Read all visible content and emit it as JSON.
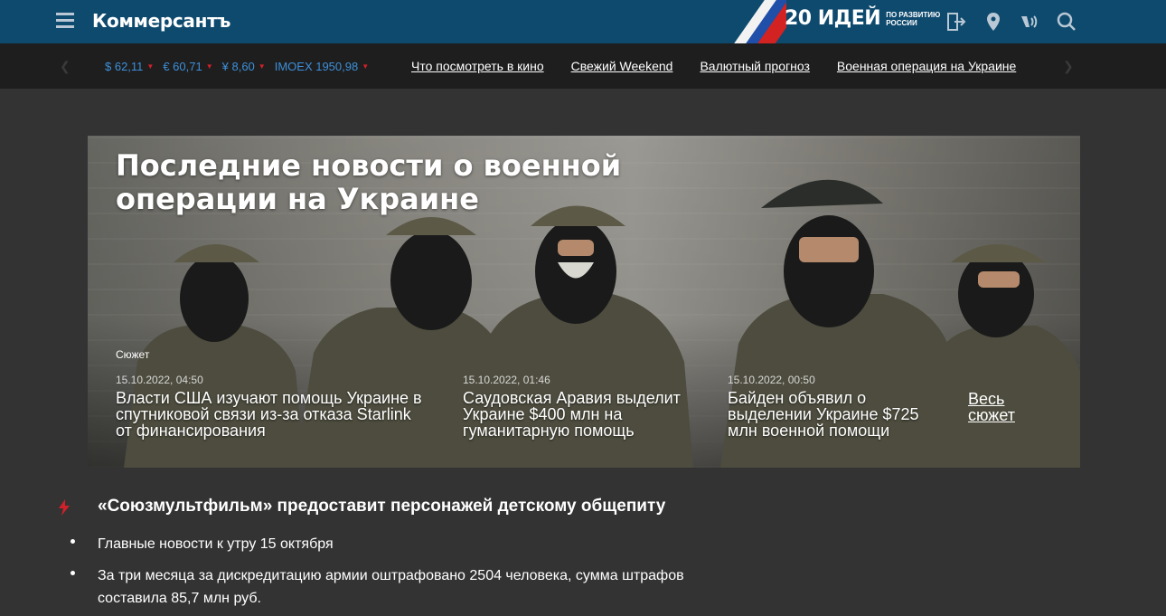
{
  "header": {
    "logo": "Коммерсантъ",
    "promo_big": "20 ИДЕЙ",
    "promo_small_1": "ПО РАЗВИТИЮ",
    "promo_small_2": "РОССИИ",
    "icons": [
      "hamburger-menu-icon",
      "login-icon",
      "location-icon",
      "radio-icon",
      "search-icon"
    ]
  },
  "subnav": {
    "rates": [
      {
        "label": "$ 62,11",
        "trend": "down"
      },
      {
        "label": "€ 60,71",
        "trend": "down"
      },
      {
        "label": "¥ 8,60",
        "trend": "down"
      },
      {
        "label": "IMOEX 1950,98",
        "trend": "down"
      }
    ],
    "links": [
      "Что посмотреть в кино",
      "Свежий Weekend",
      "Валютный прогноз",
      "Военная операция на Украине"
    ]
  },
  "hero": {
    "title_line1": "Последние новости о военной",
    "title_line2": "операции на Украине",
    "tag": "Сюжет",
    "stories": [
      {
        "date": "15.10.2022, 04:50",
        "headline": "Власти США изучают помощь Украине в спутниковой связи из-за отказа Starlink от финансирования"
      },
      {
        "date": "15.10.2022, 01:46",
        "headline": "Саудовская Аравия выделит Украине $400 млн на гуманитарную помощь"
      },
      {
        "date": "15.10.2022, 00:50",
        "headline": "Байден объявил о выделении Украине $725 млн военной помощи"
      }
    ],
    "all_link_1": "Весь",
    "all_link_2": "сюжет"
  },
  "news": {
    "lead": "«Союзмультфильм» предоставит персонажей детскому общепиту",
    "items": [
      {
        "line1": "Главные новости к утру 15 октября",
        "line2": ""
      },
      {
        "line1": "За три месяца за дискредитацию армии оштрафовано 2504 человека, сумма штрафов",
        "line2": "составила 85,7 млн руб."
      }
    ]
  },
  "colors": {
    "header_bg": "#0e4a6e",
    "subnav_bg": "#1e1e1e",
    "page_bg": "#333333",
    "rate_blue": "#3d8fd9",
    "down_red": "#d0202a"
  }
}
